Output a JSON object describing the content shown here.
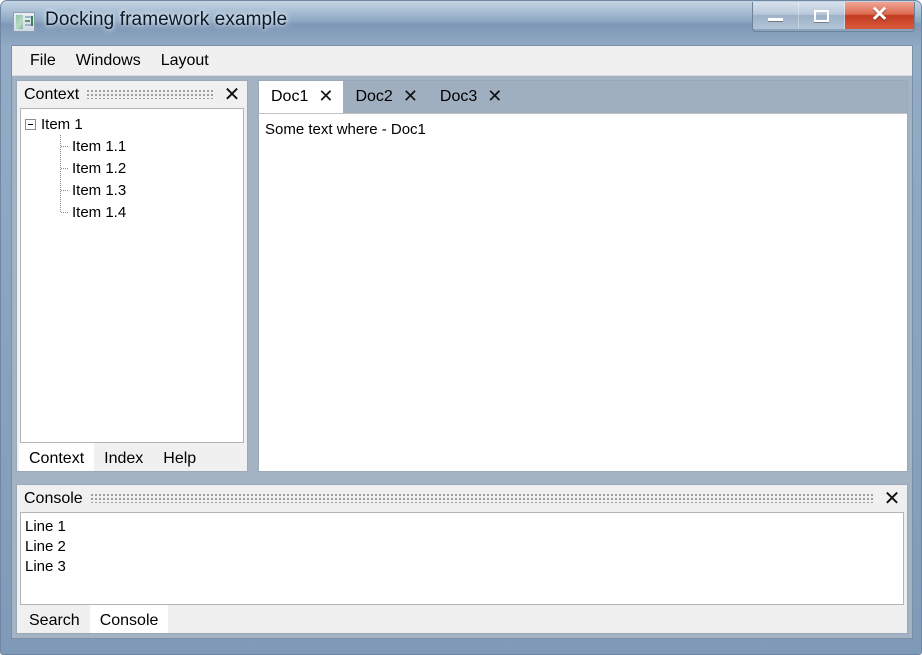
{
  "window": {
    "title": "Docking framework example",
    "icon": "app-window-icon",
    "controls": {
      "minimize": "–",
      "maximize": "❑",
      "close": "✕"
    },
    "close_color": "#c33c22",
    "titlebar_color": "#8aa4c0"
  },
  "menu": {
    "items": [
      {
        "label": "File"
      },
      {
        "label": "Windows"
      },
      {
        "label": "Layout"
      }
    ]
  },
  "left_dock": {
    "header": {
      "title": "Context",
      "close_icon": "✕",
      "grip": "dotted-grip"
    },
    "tree": {
      "root": {
        "label": "Item 1",
        "expanded": true,
        "toggle_icon": "minus-box-icon"
      },
      "children": [
        {
          "label": "Item 1.1"
        },
        {
          "label": "Item 1.2"
        },
        {
          "label": "Item 1.3"
        },
        {
          "label": "Item 1.4"
        }
      ]
    },
    "tabs": [
      {
        "label": "Context",
        "active": true
      },
      {
        "label": "Index",
        "active": false
      },
      {
        "label": "Help",
        "active": false
      }
    ]
  },
  "documents": {
    "tabs": [
      {
        "label": "Doc1",
        "close_icon": "✕",
        "active": true
      },
      {
        "label": "Doc2",
        "close_icon": "✕",
        "active": false
      },
      {
        "label": "Doc3",
        "close_icon": "✕",
        "active": false
      }
    ],
    "content": "Some text where - Doc1"
  },
  "bottom_dock": {
    "header": {
      "title": "Console",
      "close_icon": "✕",
      "grip": "dotted-grip"
    },
    "lines": [
      "Line 1",
      "Line 2",
      "Line 3"
    ],
    "tabs": [
      {
        "label": "Search",
        "active": false
      },
      {
        "label": "Console",
        "active": true
      }
    ]
  }
}
